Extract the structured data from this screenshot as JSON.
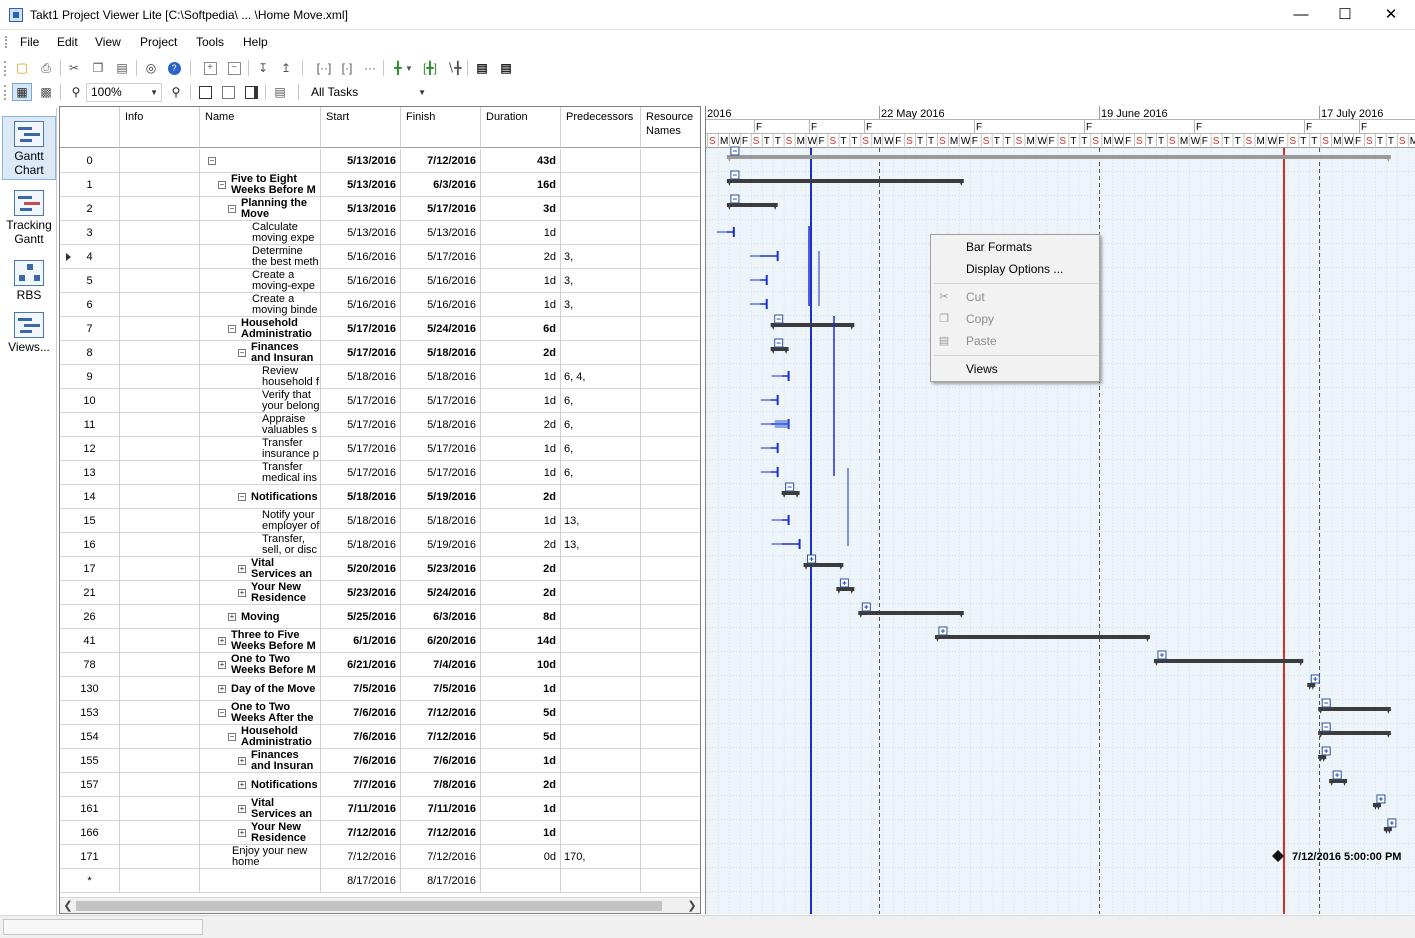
{
  "window": {
    "title": "Takt1 Project Viewer Lite [C:\\Softpedia\\ ... \\Home Move.xml]",
    "minimize": "—",
    "maximize": "☐",
    "close": "✕"
  },
  "menu": [
    "File",
    "Edit",
    "View",
    "Project",
    "Tools",
    "Help"
  ],
  "toolbar2": {
    "zoom_value": "100%",
    "filter_value": "All Tasks"
  },
  "sidebar": [
    {
      "label": "Gantt Chart",
      "icon": "gantt-chart-icon",
      "active": true
    },
    {
      "label": "Tracking Gantt",
      "icon": "tracking-gantt-icon",
      "active": false
    },
    {
      "label": "RBS",
      "icon": "rbs-icon",
      "active": false
    },
    {
      "label": "Views...",
      "icon": "views-icon",
      "active": false
    }
  ],
  "columns": {
    "info": "Info",
    "name": "Name",
    "start": "Start",
    "finish": "Finish",
    "duration": "Duration",
    "predecessors": "Predecessors",
    "resource": "Resource Names"
  },
  "rows": [
    {
      "id": "0",
      "name": "",
      "start": "5/13/2016",
      "finish": "7/12/2016",
      "duration": "43d",
      "pred": "",
      "bold": true,
      "level": 0,
      "toggle": "minus"
    },
    {
      "id": "1",
      "name": "Five to Eight Weeks Before M",
      "start": "5/13/2016",
      "finish": "6/3/2016",
      "duration": "16d",
      "pred": "",
      "bold": true,
      "level": 1,
      "toggle": "minus"
    },
    {
      "id": "2",
      "name": "Planning the Move",
      "start": "5/13/2016",
      "finish": "5/17/2016",
      "duration": "3d",
      "pred": "",
      "bold": true,
      "level": 2,
      "toggle": "minus"
    },
    {
      "id": "3",
      "name": "Calculate moving expe",
      "start": "5/13/2016",
      "finish": "5/13/2016",
      "duration": "1d",
      "pred": "",
      "bold": false,
      "level": 3,
      "toggle": ""
    },
    {
      "id": "4",
      "name": "Determine the best meth",
      "start": "5/16/2016",
      "finish": "5/17/2016",
      "duration": "2d",
      "pred": "3,",
      "bold": false,
      "level": 3,
      "toggle": "",
      "marker": true
    },
    {
      "id": "5",
      "name": "Create a moving-expe",
      "start": "5/16/2016",
      "finish": "5/16/2016",
      "duration": "1d",
      "pred": "3,",
      "bold": false,
      "level": 3,
      "toggle": ""
    },
    {
      "id": "6",
      "name": "Create a moving binde",
      "start": "5/16/2016",
      "finish": "5/16/2016",
      "duration": "1d",
      "pred": "3,",
      "bold": false,
      "level": 3,
      "toggle": ""
    },
    {
      "id": "7",
      "name": "Household Administratio",
      "start": "5/17/2016",
      "finish": "5/24/2016",
      "duration": "6d",
      "pred": "",
      "bold": true,
      "level": 2,
      "toggle": "minus"
    },
    {
      "id": "8",
      "name": "Finances and Insuran",
      "start": "5/17/2016",
      "finish": "5/18/2016",
      "duration": "2d",
      "pred": "",
      "bold": true,
      "level": 3,
      "toggle": "minus"
    },
    {
      "id": "9",
      "name": "Review household f",
      "start": "5/18/2016",
      "finish": "5/18/2016",
      "duration": "1d",
      "pred": "6, 4,",
      "bold": false,
      "level": 4,
      "toggle": ""
    },
    {
      "id": "10",
      "name": "Verify that your belong",
      "start": "5/17/2016",
      "finish": "5/17/2016",
      "duration": "1d",
      "pred": "6,",
      "bold": false,
      "level": 4,
      "toggle": ""
    },
    {
      "id": "11",
      "name": "Appraise valuables s",
      "start": "5/17/2016",
      "finish": "5/18/2016",
      "duration": "2d",
      "pred": "6,",
      "bold": false,
      "level": 4,
      "toggle": ""
    },
    {
      "id": "12",
      "name": "Transfer insurance p",
      "start": "5/17/2016",
      "finish": "5/17/2016",
      "duration": "1d",
      "pred": "6,",
      "bold": false,
      "level": 4,
      "toggle": ""
    },
    {
      "id": "13",
      "name": "Transfer medical ins",
      "start": "5/17/2016",
      "finish": "5/17/2016",
      "duration": "1d",
      "pred": "6,",
      "bold": false,
      "level": 4,
      "toggle": ""
    },
    {
      "id": "14",
      "name": "Notifications",
      "start": "5/18/2016",
      "finish": "5/19/2016",
      "duration": "2d",
      "pred": "",
      "bold": true,
      "level": 3,
      "toggle": "minus"
    },
    {
      "id": "15",
      "name": "Notify your employer of",
      "start": "5/18/2016",
      "finish": "5/18/2016",
      "duration": "1d",
      "pred": "13,",
      "bold": false,
      "level": 4,
      "toggle": ""
    },
    {
      "id": "16",
      "name": "Transfer, sell, or disc",
      "start": "5/18/2016",
      "finish": "5/19/2016",
      "duration": "2d",
      "pred": "13,",
      "bold": false,
      "level": 4,
      "toggle": ""
    },
    {
      "id": "17",
      "name": "Vital Services an",
      "start": "5/20/2016",
      "finish": "5/23/2016",
      "duration": "2d",
      "pred": "",
      "bold": true,
      "level": 3,
      "toggle": "plus"
    },
    {
      "id": "21",
      "name": "Your New Residence",
      "start": "5/23/2016",
      "finish": "5/24/2016",
      "duration": "2d",
      "pred": "",
      "bold": true,
      "level": 3,
      "toggle": "plus"
    },
    {
      "id": "26",
      "name": "Moving",
      "start": "5/25/2016",
      "finish": "6/3/2016",
      "duration": "8d",
      "pred": "",
      "bold": true,
      "level": 2,
      "toggle": "plus"
    },
    {
      "id": "41",
      "name": "Three to Five Weeks Before M",
      "start": "6/1/2016",
      "finish": "6/20/2016",
      "duration": "14d",
      "pred": "",
      "bold": true,
      "level": 1,
      "toggle": "plus"
    },
    {
      "id": "78",
      "name": "One to Two Weeks Before M",
      "start": "6/21/2016",
      "finish": "7/4/2016",
      "duration": "10d",
      "pred": "",
      "bold": true,
      "level": 1,
      "toggle": "plus"
    },
    {
      "id": "130",
      "name": "Day of the Move",
      "start": "7/5/2016",
      "finish": "7/5/2016",
      "duration": "1d",
      "pred": "",
      "bold": true,
      "level": 1,
      "toggle": "plus"
    },
    {
      "id": "153",
      "name": "One to Two Weeks After the",
      "start": "7/6/2016",
      "finish": "7/12/2016",
      "duration": "5d",
      "pred": "",
      "bold": true,
      "level": 1,
      "toggle": "minus"
    },
    {
      "id": "154",
      "name": "Household Administratio",
      "start": "7/6/2016",
      "finish": "7/12/2016",
      "duration": "5d",
      "pred": "",
      "bold": true,
      "level": 2,
      "toggle": "minus"
    },
    {
      "id": "155",
      "name": "Finances and Insuran",
      "start": "7/6/2016",
      "finish": "7/6/2016",
      "duration": "1d",
      "pred": "",
      "bold": true,
      "level": 3,
      "toggle": "plus"
    },
    {
      "id": "157",
      "name": "Notifications",
      "start": "7/7/2016",
      "finish": "7/8/2016",
      "duration": "2d",
      "pred": "",
      "bold": true,
      "level": 3,
      "toggle": "plus"
    },
    {
      "id": "161",
      "name": "Vital Services an",
      "start": "7/11/2016",
      "finish": "7/11/2016",
      "duration": "1d",
      "pred": "",
      "bold": true,
      "level": 3,
      "toggle": "plus"
    },
    {
      "id": "166",
      "name": "Your New Residence",
      "start": "7/12/2016",
      "finish": "7/12/2016",
      "duration": "1d",
      "pred": "",
      "bold": true,
      "level": 3,
      "toggle": "plus"
    },
    {
      "id": "171",
      "name": "Enjoy your new home",
      "start": "7/12/2016",
      "finish": "7/12/2016",
      "duration": "0d",
      "pred": "170,",
      "bold": false,
      "level": 1,
      "toggle": ""
    },
    {
      "id": "*",
      "name": "",
      "start": "8/17/2016",
      "finish": "8/17/2016",
      "duration": "",
      "pred": "",
      "bold": false,
      "level": 0,
      "toggle": ""
    }
  ],
  "timescale": {
    "weeks": [
      "2016",
      "22 May 2016",
      "19 June 2016",
      "17 July 2016"
    ],
    "days": [
      "S",
      "M",
      "W",
      "F",
      "S",
      "T",
      "T",
      "S",
      "M",
      "W",
      "F",
      "S",
      "T",
      "T",
      "S",
      "M",
      "W",
      "F",
      "S",
      "T",
      "T",
      "S",
      "M",
      "W",
      "F",
      "S",
      "T",
      "T",
      "S",
      "M",
      "W",
      "F",
      "S",
      "T",
      "T",
      "S",
      "M",
      "W",
      "F",
      "S",
      "T",
      "T",
      "S",
      "M",
      "W",
      "F",
      "S",
      "T",
      "T",
      "S",
      "M",
      "W",
      "F",
      "S",
      "T",
      "T",
      "S",
      "M",
      "W",
      "F",
      "S",
      "T",
      "T",
      "S",
      "M",
      "W"
    ],
    "milestone_label": "7/12/2016 5:00:00 PM"
  },
  "context_menu": [
    {
      "label": "Bar Formats",
      "enabled": true,
      "icon": ""
    },
    {
      "label": "Display Options ...",
      "enabled": true,
      "icon": ""
    },
    {
      "label": "Cut",
      "enabled": false,
      "icon": "scissors-icon"
    },
    {
      "label": "Copy",
      "enabled": false,
      "icon": "copy-icon"
    },
    {
      "label": "Paste",
      "enabled": false,
      "icon": "paste-icon"
    },
    {
      "label": "Views",
      "enabled": true,
      "icon": ""
    }
  ],
  "colors": {
    "today_line": "#d0302a",
    "status_line": "#1b2fd0",
    "summary_bar": "#3c3c3c",
    "task_link": "#1b2fd0",
    "weekend_letter": "#d0302a"
  }
}
